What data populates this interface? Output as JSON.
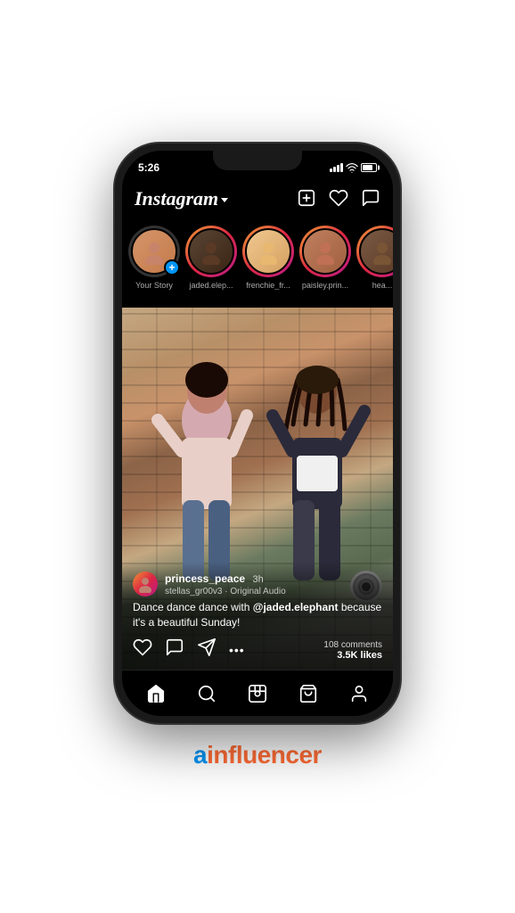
{
  "page": {
    "background": "#ffffff"
  },
  "status_bar": {
    "time": "5:26",
    "signal": "●●●●",
    "wifi": "wifi",
    "battery": "battery"
  },
  "header": {
    "logo": "Instagram",
    "dropdown_label": "dropdown",
    "icons": {
      "add": "+",
      "heart": "♡",
      "messenger": "messenger"
    }
  },
  "stories": [
    {
      "id": "your-story",
      "label": "Your Story",
      "has_plus": true,
      "has_ring": false
    },
    {
      "id": "jaded-elephant",
      "label": "jaded.elep...",
      "has_plus": false,
      "has_ring": true
    },
    {
      "id": "frenchie",
      "label": "frenchie_fr...",
      "has_plus": false,
      "has_ring": true
    },
    {
      "id": "paisley",
      "label": "paisley.prin...",
      "has_plus": false,
      "has_ring": true
    },
    {
      "id": "hea",
      "label": "hea...",
      "has_plus": false,
      "has_ring": true
    }
  ],
  "post": {
    "username": "princess_peace",
    "time": "3h",
    "audio": "stellas_gr00v3 · Original Audio",
    "caption": "Dance dance dance with @jaded.elephant because it's a beautiful Sunday!",
    "caption_mention": "@jaded.elephant",
    "comments_count": "108 comments",
    "likes_count": "3.5K likes"
  },
  "bottom_nav": {
    "items": [
      {
        "id": "home",
        "label": "Home"
      },
      {
        "id": "search",
        "label": "Search"
      },
      {
        "id": "reels",
        "label": "Reels"
      },
      {
        "id": "shop",
        "label": "Shop"
      },
      {
        "id": "profile",
        "label": "Profile"
      }
    ]
  },
  "brand": {
    "prefix": "a",
    "suffix": "influencer"
  }
}
